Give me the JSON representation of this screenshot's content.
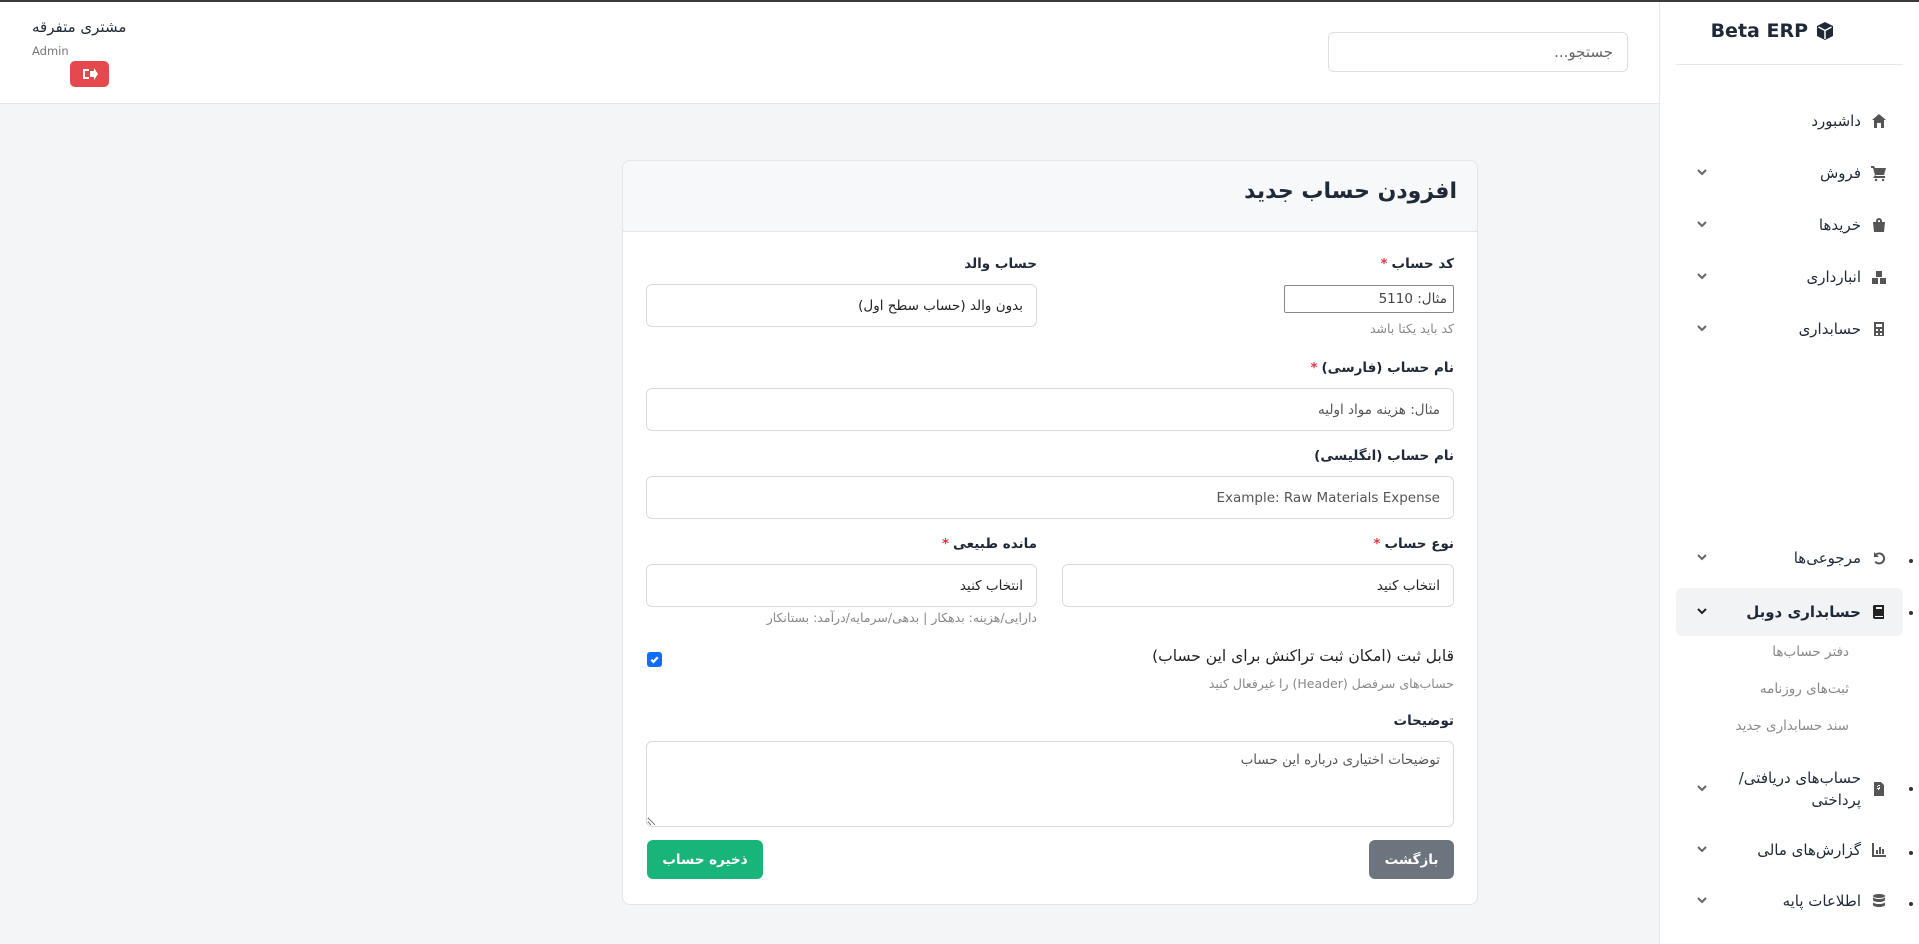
{
  "app": {
    "brand": "Beta ERP"
  },
  "header": {
    "search_placeholder": "جستجو...",
    "user_name": "مشتری متفرقه",
    "user_role": "Admin"
  },
  "sidebar": {
    "items": [
      {
        "label": "داشبورد",
        "icon": "home-icon"
      },
      {
        "label": "فروش",
        "icon": "cart-icon"
      },
      {
        "label": "خریدها",
        "icon": "bag-icon"
      },
      {
        "label": "انبارداری",
        "icon": "boxes-icon"
      },
      {
        "label": "حسابداری",
        "icon": "calculator-icon"
      },
      {
        "label": "مرجوعی‌ها",
        "icon": "undo-icon"
      },
      {
        "label": "حسابداری دوبل",
        "icon": "book-icon"
      },
      {
        "label": "حساب‌های دریافتی/پرداختی",
        "icon": "invoice-icon"
      },
      {
        "label": "گزارش‌های مالی",
        "icon": "chart-icon"
      },
      {
        "label": "اطلاعات پایه",
        "icon": "database-icon"
      }
    ],
    "subitems": [
      "دفتر حساب‌ها",
      "ثبت‌های روزنامه",
      "سند حسابداری جدید"
    ]
  },
  "form": {
    "title": "افزودن حساب جدید",
    "code_label": "کد حساب",
    "code_placeholder": "مثال: 5110",
    "code_hint": "کد باید یکتا باشد",
    "parent_label": "حساب والد",
    "parent_value": "بدون والد (حساب سطح اول)",
    "name_fa_label": "نام حساب (فارسی)",
    "name_fa_placeholder": "مثال: هزینه مواد اولیه",
    "name_en_label": "نام حساب (انگلیسی)",
    "name_en_placeholder": "Example: Raw Materials Expense",
    "type_label": "نوع حساب",
    "type_value": "انتخاب کنید",
    "balance_label": "مانده طبیعی",
    "balance_value": "انتخاب کنید",
    "balance_hint": "دارایی/هزینه: بدهکار | بدهی/سرمایه/درآمد: بستانکار",
    "postable_label": "قابل ثبت (امکان ثبت تراکنش برای این حساب)",
    "postable_hint": "حساب‌های سرفصل (Header) را غیرفعال کنید",
    "postable_checked": true,
    "desc_label": "توضیحات",
    "desc_placeholder": "توضیحات اختیاری درباره این حساب",
    "back_label": "بازگشت",
    "save_label": "ذخیره حساب",
    "required_mark": "*"
  },
  "colors": {
    "primary": "#0d6efd",
    "success": "#19b47a",
    "danger": "#e5484d",
    "secondary": "#6c757d"
  }
}
